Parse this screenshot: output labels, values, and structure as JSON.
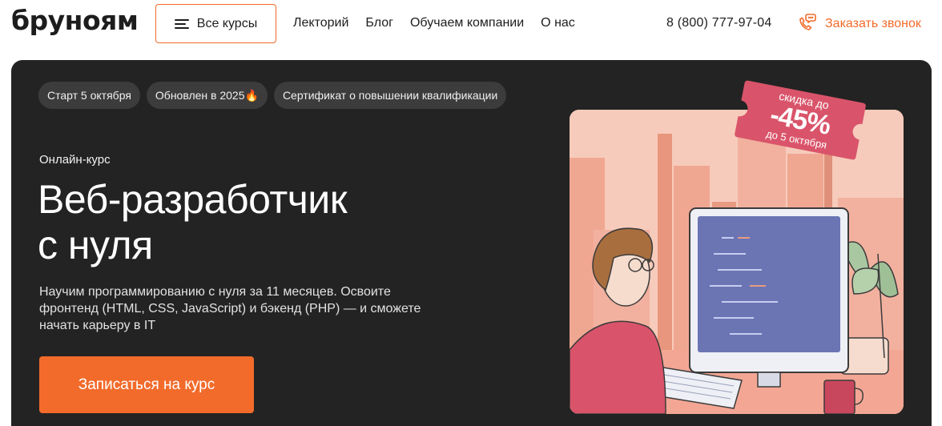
{
  "header": {
    "logo": "бруноям",
    "all_courses_label": "Все курсы",
    "nav": [
      "Лекторий",
      "Блог",
      "Обучаем компании",
      "О нас"
    ],
    "phone": "8 (800) 777-97-04",
    "callback_label": "Заказать звонок"
  },
  "hero": {
    "chips": [
      "Старт 5 октября",
      "Обновлен в 2025🔥",
      "Сертификат о повышении квалификации"
    ],
    "kicker": "Онлайн-курс",
    "title_line1": "Веб-разработчик",
    "title_line2": "с нуля",
    "description": "Научим программированию с нуля за 11 месяцев. Освоите фронтенд (HTML, CSS, JavaScript) и бэкенд (PHP) — и сможете начать карьеру в IT",
    "cta_label": "Записаться на курс",
    "discount": {
      "line1": "скидка до",
      "value": "-45%",
      "line3": "до 5 октября"
    }
  },
  "colors": {
    "accent": "#f26b2b",
    "hero_bg": "#232323",
    "badge_bg": "#d9546a"
  },
  "icons": [
    "menu-icon",
    "phone-chat-icon"
  ]
}
